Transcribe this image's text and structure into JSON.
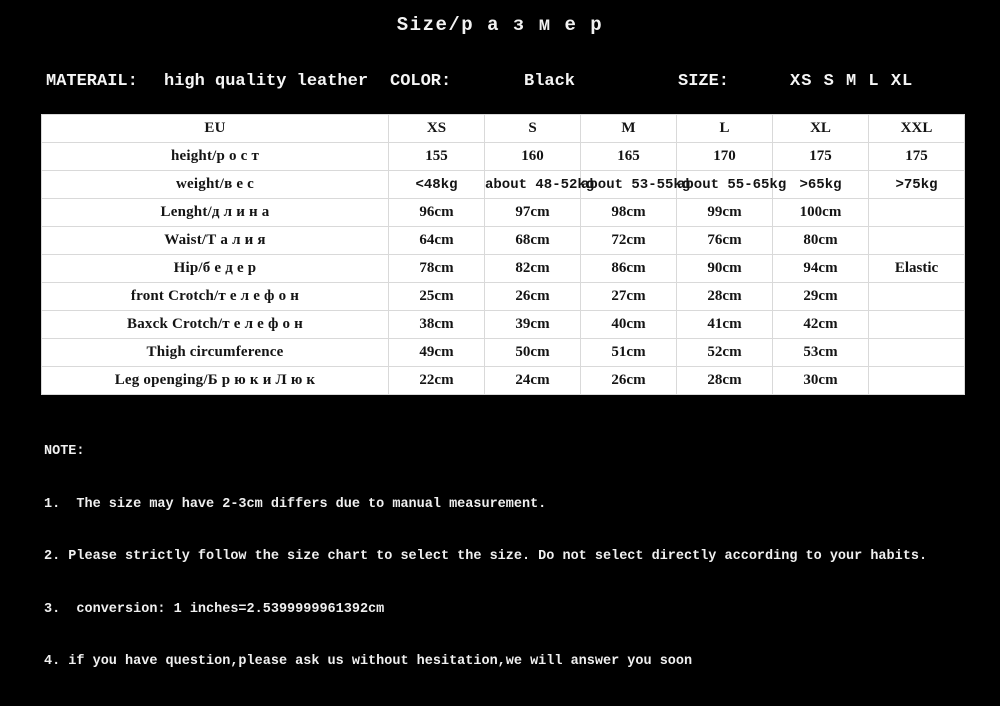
{
  "title": "Size/р а з м е р",
  "info": {
    "material_label": "MATERAIL:",
    "material_value": "high quality leather",
    "color_label": "COLOR:",
    "color_value": "Black",
    "size_label": "SIZE:",
    "size_value": "XS S M L XL"
  },
  "chart_data": {
    "type": "table",
    "title": "Size/размер",
    "columns": [
      "EU",
      "XS",
      "S",
      "M",
      "L",
      "XL",
      "XXL"
    ],
    "rows": [
      {
        "label": "height/р о с т",
        "values": [
          "155",
          "160",
          "165",
          "170",
          "175",
          "175"
        ]
      },
      {
        "label": "weight/в е с",
        "values": [
          "<48kg",
          "about 48-52kg",
          "about 53-55kg",
          "about 55-65kg",
          ">65kg",
          ">75kg"
        ]
      },
      {
        "label": "Lenght/д л и н а",
        "values": [
          "96cm",
          "97cm",
          "98cm",
          "99cm",
          "100cm",
          ""
        ]
      },
      {
        "label": "Waist/Т а л и я",
        "values": [
          "64cm",
          "68cm",
          "72cm",
          "76cm",
          "80cm",
          ""
        ]
      },
      {
        "label": "Hip/б е д е р",
        "values": [
          "78cm",
          "82cm",
          "86cm",
          "90cm",
          "94cm",
          "Elastic"
        ]
      },
      {
        "label": "front Crotch/т е л е ф о н",
        "values": [
          "25cm",
          "26cm",
          "27cm",
          "28cm",
          "29cm",
          ""
        ]
      },
      {
        "label": "Baxck Crotch/т е л е ф о н",
        "values": [
          "38cm",
          "39cm",
          "40cm",
          "41cm",
          "42cm",
          ""
        ]
      },
      {
        "label": "Thigh circumference",
        "values": [
          "49cm",
          "50cm",
          "51cm",
          "52cm",
          "53cm",
          ""
        ]
      },
      {
        "label": "Leg openging/Б р ю к и  Л ю к",
        "values": [
          "22cm",
          "24cm",
          "26cm",
          "28cm",
          "30cm",
          ""
        ]
      }
    ]
  },
  "notes": {
    "heading": "NOTE:",
    "lines": [
      "1.  The size may have 2-3cm differs due to manual measurement.",
      "2. Please strictly follow the size chart to select the size. Do not select directly according to your habits.",
      "3.  conversion: 1 inches=2.5399999961392cm",
      "4. if you have question,please ask us without hesitation,we will answer you soon"
    ]
  },
  "colors": {
    "background": "#000000",
    "text_on_dark": "#f2f2f2",
    "table_background": "#ffffff",
    "table_text": "#141414",
    "table_gridline": "#d9d9d9"
  }
}
